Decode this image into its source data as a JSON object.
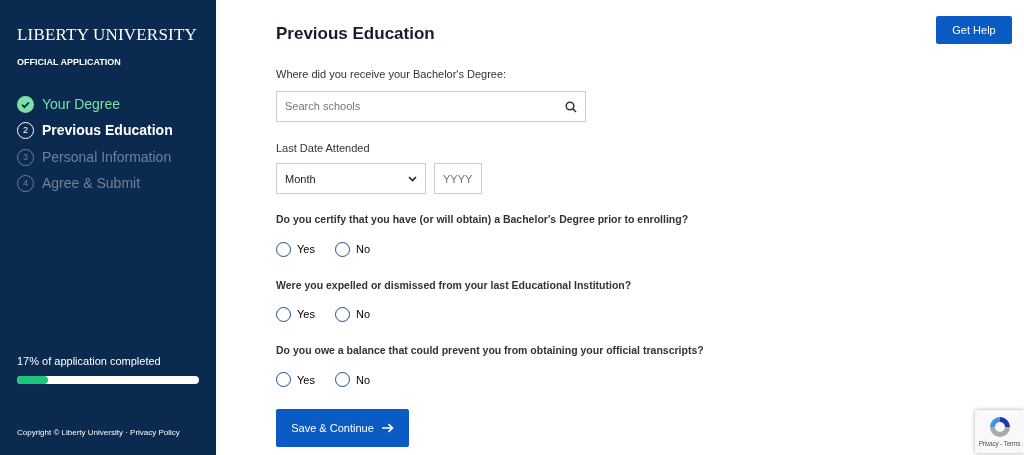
{
  "sidebar": {
    "brand": "LIBERTY UNIVERSITY",
    "subtitle": "OFFICIAL APPLICATION",
    "steps": [
      {
        "label": "Your Degree",
        "kind": "done"
      },
      {
        "number": "2",
        "label": "Previous Education",
        "kind": "current"
      },
      {
        "number": "3",
        "label": "Personal Information",
        "kind": "locked"
      },
      {
        "number": "4",
        "label": "Agree & Submit",
        "kind": "locked"
      }
    ],
    "progress": {
      "text": "17% of application completed",
      "level": 0.17
    },
    "footer": {
      "copyright": "Copyright © Liberty University ·",
      "link": "Privacy Policy"
    }
  },
  "header": {
    "title": "Previous Education",
    "help_button": "Get Help"
  },
  "school": {
    "label": "Where did you receive your Bachelor's Degree:",
    "placeholder": "Search schools"
  },
  "date": {
    "label": "Last Date Attended",
    "month": "Month",
    "year_placeholder": "YYYY"
  },
  "questions": [
    {
      "text": "Do you certify that you have (or will obtain) a Bachelor's Degree prior to enrolling?",
      "options": [
        {
          "label": "Yes",
          "selected": false
        },
        {
          "label": "No",
          "selected": false
        }
      ]
    },
    {
      "text": "Were you expelled or dismissed from your last Educational Institution?",
      "options": [
        {
          "label": "Yes",
          "selected": false
        },
        {
          "label": "No",
          "selected": false
        }
      ]
    },
    {
      "text": "Do you owe a balance that could prevent you from obtaining your official transcripts?",
      "options": [
        {
          "label": "Yes",
          "selected": false
        },
        {
          "label": "No",
          "selected": false
        }
      ]
    }
  ],
  "submit_button": "Save & Continue",
  "recaptcha": {
    "text": "Privacy - Terms"
  }
}
